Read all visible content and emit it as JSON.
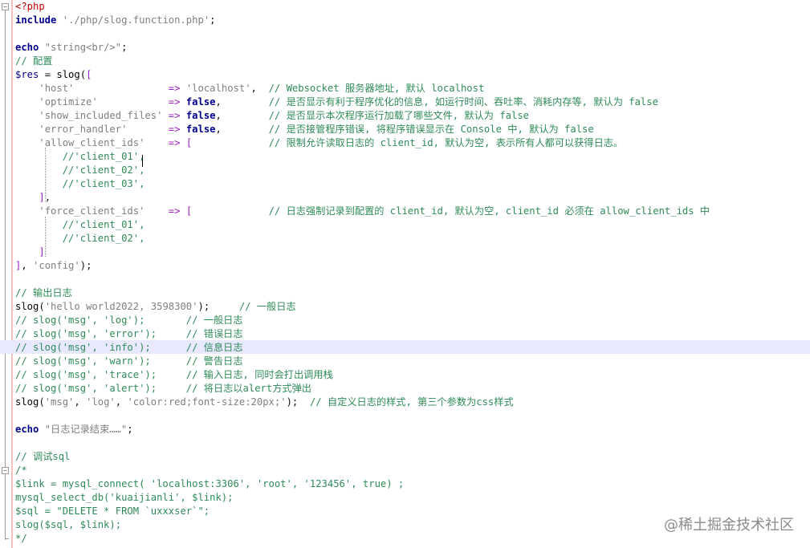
{
  "editor": {
    "language": "php",
    "highlighted_line": 26,
    "lines": [
      "<?php",
      "include './php/slog.function.php';",
      "",
      "echo \"string<br/>\";",
      "// 配置",
      "$res = slog([",
      "    'host'                => 'localhost',  // Websocket 服务器地址, 默认 localhost",
      "    'optimize'            => false,        // 是否显示有利于程序优化的信息, 如运行时间、吞吐率、消耗内存等, 默认为 false",
      "    'show_included_files' => false,        // 是否显示本次程序运行加载了哪些文件, 默认为 false",
      "    'error_handler'       => false,        // 是否接管程序错误, 将程序错误显示在 Console 中, 默认为 false",
      "    'allow_client_ids'    => [             // 限制允许读取日志的 client_id, 默认为空, 表示所有人都可以获得日志。",
      "        //'client_01',",
      "        //'client_02',",
      "        //'client_03',",
      "    ],",
      "    'force_client_ids'    => [             // 日志强制记录到配置的 client_id, 默认为空, client_id 必须在 allow_client_ids 中",
      "        //'client_01',",
      "        //'client_02',",
      "    ]",
      "], 'config');",
      "",
      "// 输出日志",
      "slog('hello world2022, 3598300');     // 一般日志",
      "// slog('msg', 'log');       // 一般日志",
      "// slog('msg', 'error');     // 错误日志",
      "// slog('msg', 'info');      // 信息日志",
      "// slog('msg', 'warn');      // 警告日志",
      "// slog('msg', 'trace');     // 输入日志, 同时会打出调用栈",
      "// slog('msg', 'alert');     // 将日志以alert方式弹出",
      "slog('msg', 'log', 'color:red;font-size:20px;');  // 自定义日志的样式, 第三个参数为css样式",
      "",
      "echo \"日志记录结束……\";",
      "",
      "// 调试sql",
      "/*",
      "$link = mysql_connect( 'localhost:3306', 'root', '123456', true) ;",
      "mysql_select_db('kuaijianli', $link);",
      "$sql = \"DELETE * FROM `uxxxser`\";",
      "slog($sql, $link);",
      "*/"
    ]
  },
  "watermark": "@稀土掘金技术社区",
  "colors": {
    "keyword": "#00008b",
    "string": "#7f7f7f",
    "operator": "#9b1fbd",
    "comment": "#2e8b57",
    "php_tag": "#c00000",
    "current_line": "#e8e8ff"
  }
}
